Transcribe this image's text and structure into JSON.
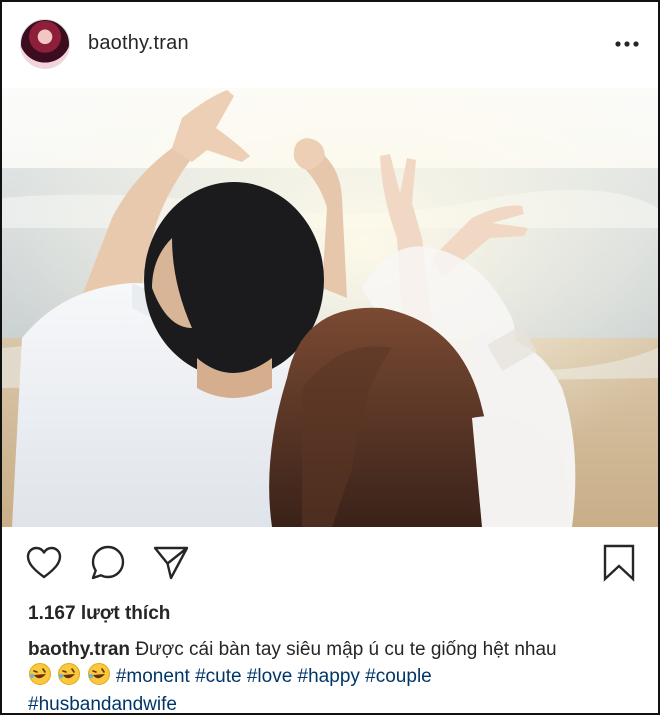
{
  "post": {
    "username": "baothy.tran",
    "likes_text": "1.167 lượt thích",
    "caption": {
      "username": "baothy.tran",
      "text": "Được cái bàn tay siêu mập ú cu te giống hệt nhau",
      "emoji_count": 3,
      "emoji_name": "rofl-emoji",
      "hashtags": [
        "#monent",
        "#cute",
        "#love",
        "#happy",
        "#couple",
        "#husbandandwife"
      ]
    }
  },
  "icons": {
    "more": "more-options-icon",
    "like": "heart-icon",
    "comment": "comment-icon",
    "share": "share-icon",
    "save": "bookmark-icon"
  },
  "colors": {
    "text": "#262626",
    "hashtag": "#003569",
    "border": "#111111"
  }
}
